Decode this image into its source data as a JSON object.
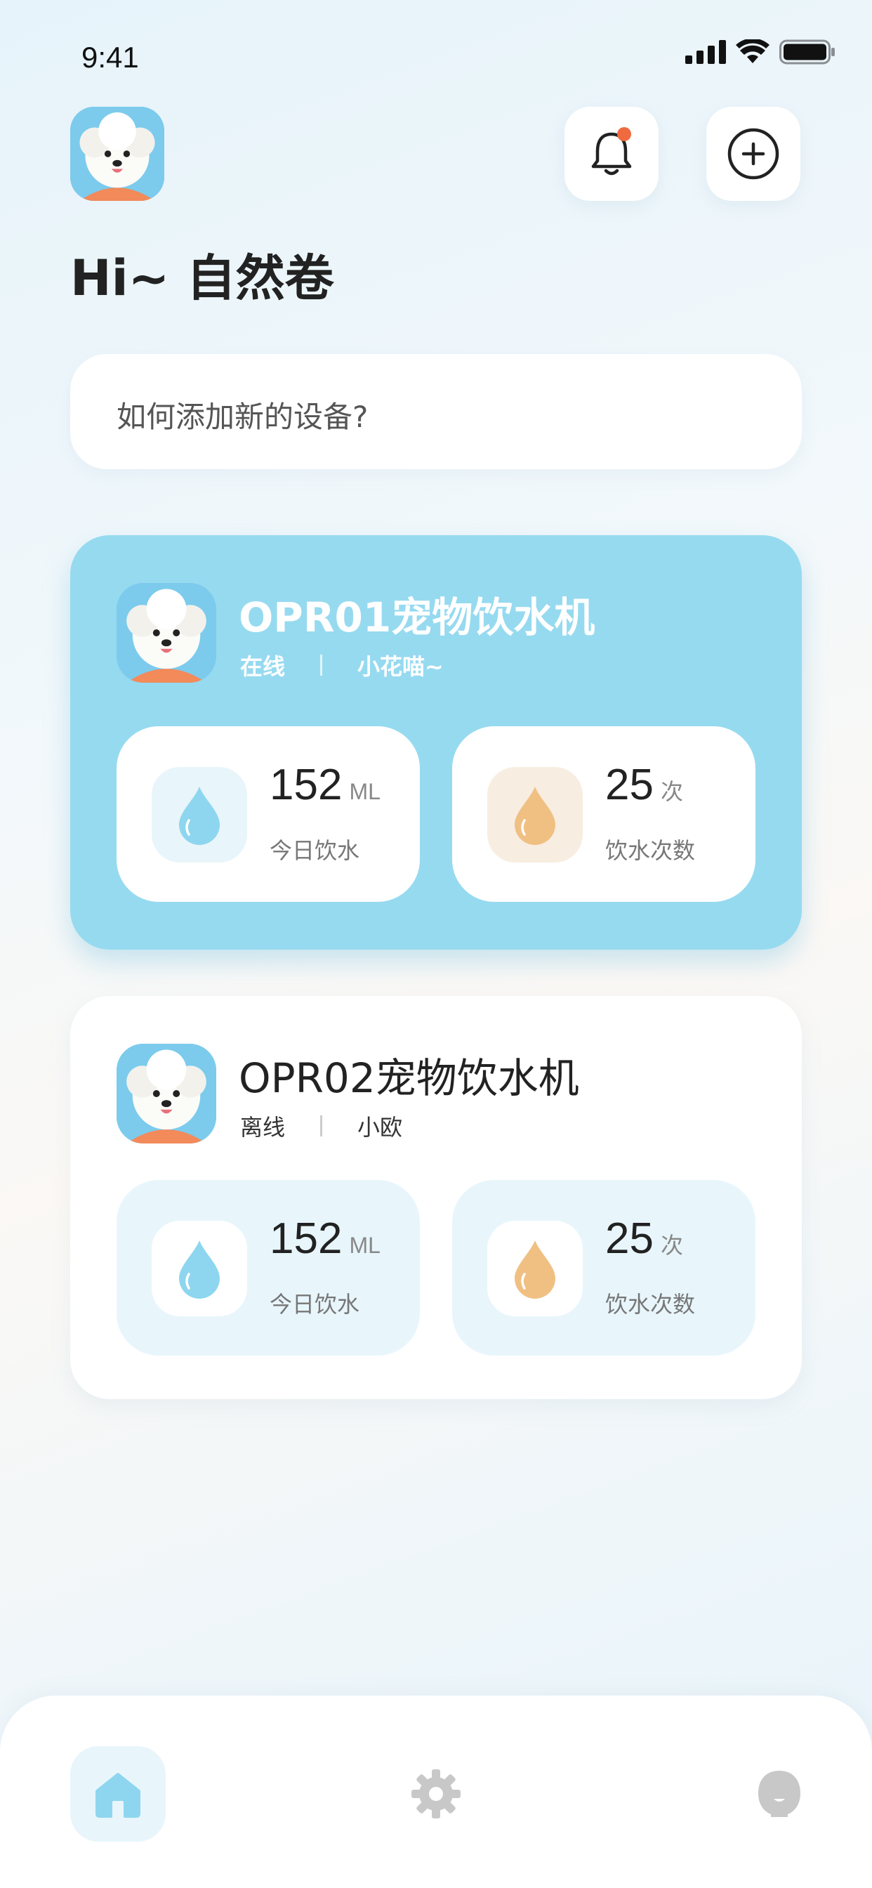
{
  "status_bar": {
    "time": "9:41"
  },
  "header": {
    "greeting": "Hi~ 自然卷"
  },
  "help": {
    "text": "如何添加新的设备?"
  },
  "devices": [
    {
      "name": "OPR01宠物饮水机",
      "status": "在线",
      "pet_name": "小花喵~",
      "water": {
        "value": "152",
        "unit": "ML",
        "label": "今日饮水"
      },
      "count": {
        "value": "25",
        "unit": "次",
        "label": "饮水次数"
      }
    },
    {
      "name": "OPR02宠物饮水机",
      "status": "离线",
      "pet_name": "小欧",
      "water": {
        "value": "152",
        "unit": "ML",
        "label": "今日饮水"
      },
      "count": {
        "value": "25",
        "unit": "次",
        "label": "饮水次数"
      }
    }
  ],
  "colors": {
    "accent": "#96daf0",
    "water_icon": "#8ed6ef",
    "count_icon": "#f0c083",
    "notification_dot": "#f06a3f"
  },
  "icons": [
    "signal-icon",
    "wifi-icon",
    "battery-icon",
    "bell-icon",
    "plus-circle-icon",
    "water-drop-icon",
    "home-icon",
    "gear-icon",
    "pet-face-icon"
  ]
}
